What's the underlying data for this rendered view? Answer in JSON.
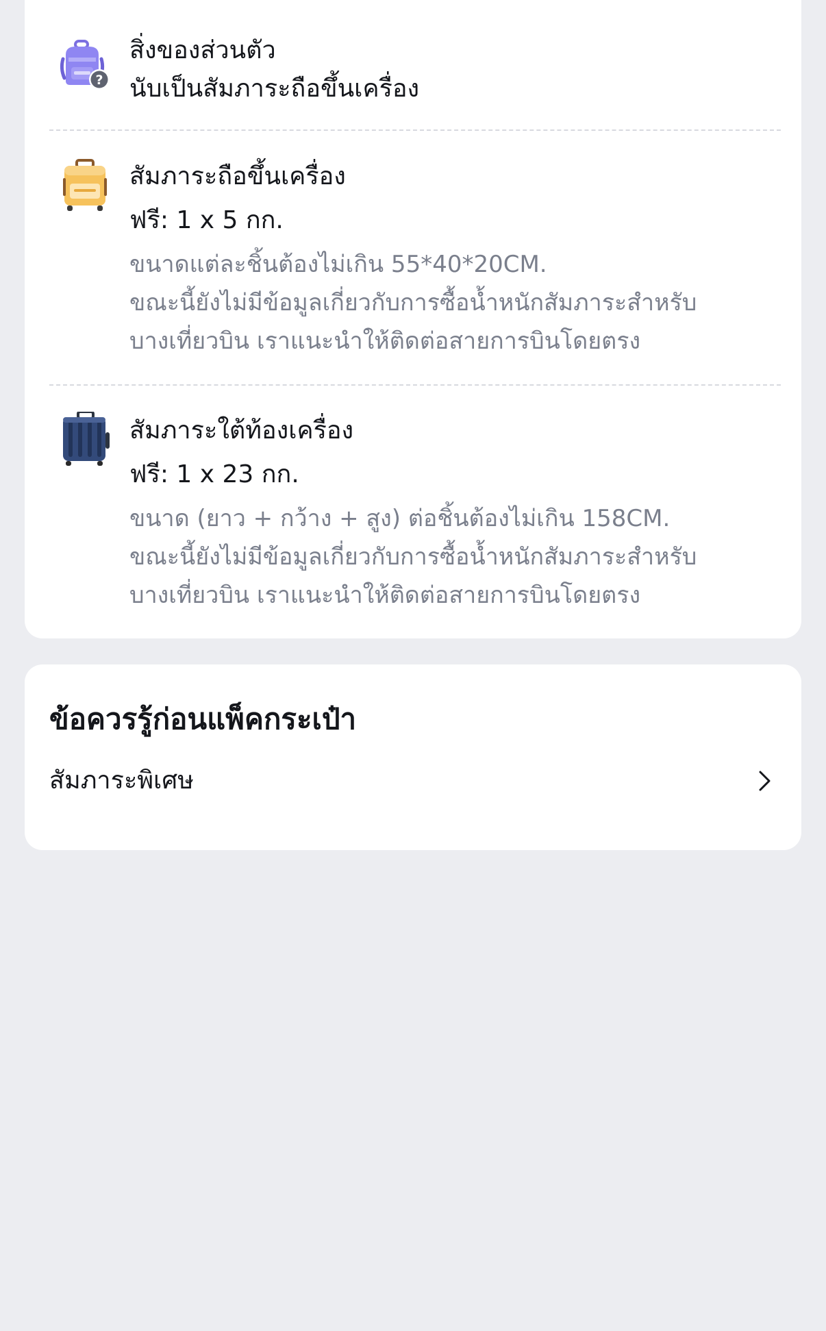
{
  "baggage": {
    "personal_item": {
      "icon": "backpack-question-icon",
      "title_line1": "สิ่งของส่วนตัว",
      "title_line2": "นับเป็นสัมภาระถือขึ้นเครื่อง"
    },
    "carry_on": {
      "icon": "yellow-carry-on-suitcase-icon",
      "title": "สัมภาระถือขึ้นเครื่อง",
      "allowance": "ฟรี: 1 x 5 กก.",
      "desc_line1": "ขนาดแต่ละชิ้นต้องไม่เกิน 55*40*20CM.",
      "desc_line2": "ขณะนี้ยังไม่มีข้อมูลเกี่ยวกับการซื้อน้ำหนักสัมภาระสำหรับ",
      "desc_line3": "บางเที่ยวบิน เราแนะนำให้ติดต่อสายการบินโดยตรง"
    },
    "checked": {
      "icon": "navy-checked-suitcase-icon",
      "title": "สัมภาระใต้ท้องเครื่อง",
      "allowance": "ฟรี: 1 x 23 กก.",
      "desc_line1": "ขนาด (ยาว + กว้าง + สูง) ต่อชิ้นต้องไม่เกิน 158CM.",
      "desc_line2": "ขณะนี้ยังไม่มีข้อมูลเกี่ยวกับการซื้อน้ำหนักสัมภาระสำหรับ",
      "desc_line3": "บางเที่ยวบิน เราแนะนำให้ติดต่อสายการบินโดยตรง"
    }
  },
  "tips": {
    "title": "ข้อควรรู้ก่อนแพ็คกระเป๋า",
    "items": [
      {
        "label": "สัมภาระพิเศษ",
        "icon": "chevron-right-icon"
      }
    ]
  },
  "colors": {
    "background": "#ecedf1",
    "card": "#ffffff",
    "primary_text": "#14161b",
    "secondary_text": "#7a7f8c",
    "divider": "#d7d9df"
  }
}
